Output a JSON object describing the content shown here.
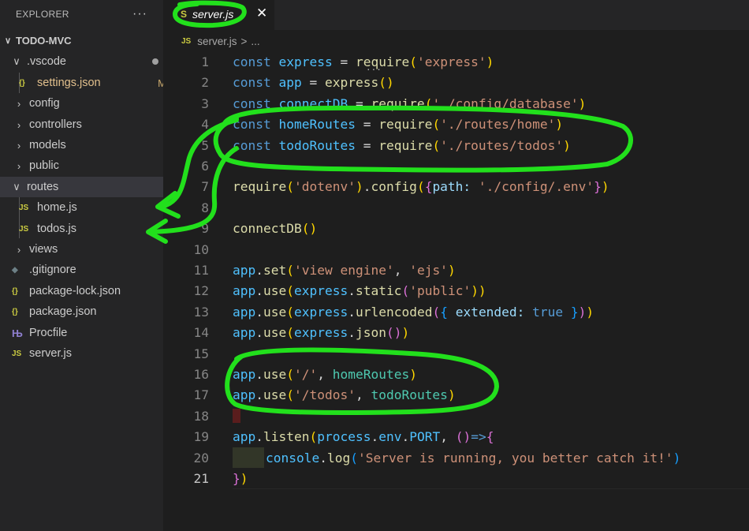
{
  "explorer": {
    "title": "EXPLORER",
    "more_label": "···",
    "project": "TODO-MVC",
    "items": [
      {
        "label": ".vscode",
        "type": "folder",
        "open": true,
        "status": "dot"
      },
      {
        "label": "settings.json",
        "type": "json",
        "badge": "M"
      },
      {
        "label": "config",
        "type": "folder"
      },
      {
        "label": "controllers",
        "type": "folder"
      },
      {
        "label": "models",
        "type": "folder"
      },
      {
        "label": "public",
        "type": "folder"
      },
      {
        "label": "routes",
        "type": "folder",
        "open": true
      },
      {
        "label": "home.js",
        "type": "js"
      },
      {
        "label": "todos.js",
        "type": "js"
      },
      {
        "label": "views",
        "type": "folder"
      },
      {
        "label": ".gitignore",
        "type": "git"
      },
      {
        "label": "package-lock.json",
        "type": "json"
      },
      {
        "label": "package.json",
        "type": "json"
      },
      {
        "label": "Procfile",
        "type": "heroku"
      },
      {
        "label": "server.js",
        "type": "js"
      }
    ]
  },
  "icons": {
    "js_label": "JS",
    "json_label": "{}",
    "s_label": "S",
    "close": "✕",
    "ellipsis": "..."
  },
  "tab": {
    "label": "server.js"
  },
  "breadcrumb": {
    "file": "server.js",
    "sep": ">",
    "rest": "..."
  },
  "code": {
    "line_numbers": [
      "1",
      "2",
      "3",
      "4",
      "5",
      "6",
      "7",
      "8",
      "9",
      "10",
      "11",
      "12",
      "13",
      "14",
      "15",
      "16",
      "17",
      "18",
      "19",
      "20",
      "21"
    ],
    "l1": [
      "const",
      "express",
      "=",
      "require",
      "(",
      "'express'",
      ")"
    ],
    "l2": [
      "const",
      "app",
      "=",
      "express",
      "()"
    ],
    "l3": [
      "const",
      "connectDB",
      "=",
      "require",
      "(",
      "'./config/database'",
      ")"
    ],
    "l4": [
      "const",
      "homeRoutes",
      "=",
      "require",
      "(",
      "'./routes/home'",
      ")"
    ],
    "l5": [
      "const",
      "todoRoutes",
      "=",
      "require",
      "(",
      "'./routes/todos'",
      ")"
    ],
    "l7": [
      "require",
      "(",
      "'dotenv'",
      ")",
      ".",
      "config",
      "(",
      "{",
      "path",
      ":",
      "'./config/.env'",
      "}",
      ")"
    ],
    "l9": [
      "connectDB",
      "()"
    ],
    "l11": [
      "app",
      ".",
      "set",
      "(",
      "'view engine'",
      ",",
      "'ejs'",
      ")"
    ],
    "l12": [
      "app",
      ".",
      "use",
      "(",
      "express",
      ".",
      "static",
      "(",
      "'public'",
      "))"
    ],
    "l13": [
      "app",
      ".",
      "use",
      "(",
      "express",
      ".",
      "urlencoded",
      "(",
      "{",
      "extended",
      ":",
      "true",
      "}",
      ")",
      ")"
    ],
    "l14": [
      "app",
      ".",
      "use",
      "(",
      "express",
      ".",
      "json",
      "()",
      ")"
    ],
    "l16": [
      "app",
      ".",
      "use",
      "(",
      "'/'",
      ",",
      "homeRoutes",
      ")"
    ],
    "l17": [
      "app",
      ".",
      "use",
      "(",
      "'/todos'",
      ",",
      "todoRoutes",
      ")"
    ],
    "l19": [
      "app",
      ".",
      "listen",
      "(",
      "process",
      ".",
      "env",
      ".",
      "PORT",
      ",",
      "()",
      "=>",
      "{"
    ],
    "l20": [
      "console",
      ".",
      "log",
      "(",
      "'Server is running, you better catch it!'",
      ")"
    ],
    "l21": [
      "}",
      ")"
    ]
  },
  "colors": {
    "annotation": "#22e01c",
    "keyword": "#569cd6",
    "variable": "#4fc1ff",
    "function": "#dcdcaa",
    "string": "#ce9178"
  }
}
